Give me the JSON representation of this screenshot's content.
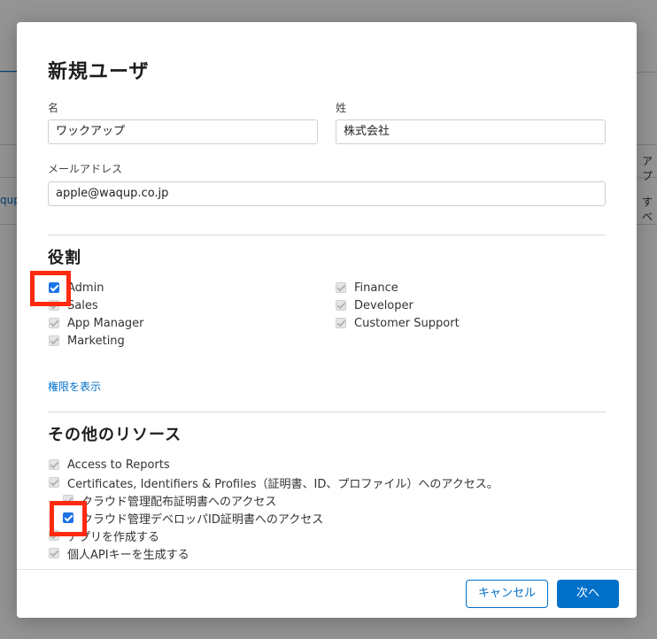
{
  "background": {
    "row1_link": "qup",
    "col_header": "アプ",
    "row1_cell": "すべ"
  },
  "modal": {
    "title": "新規ユーザ",
    "first_name": {
      "label": "名",
      "value": "ワックアップ"
    },
    "last_name": {
      "label": "姓",
      "value": "株式会社"
    },
    "email": {
      "label": "メールアドレス",
      "value": "apple@waqup.co.jp"
    },
    "roles": {
      "title": "役割",
      "left": [
        {
          "label": "Admin",
          "checked": true
        },
        {
          "label": "Sales",
          "checked": false
        },
        {
          "label": "App Manager",
          "checked": false
        },
        {
          "label": "Marketing",
          "checked": false
        }
      ],
      "right": [
        {
          "label": "Finance",
          "checked": false
        },
        {
          "label": "Developer",
          "checked": false
        },
        {
          "label": "Customer Support",
          "checked": false
        }
      ],
      "show_permissions_link": "権限を表示"
    },
    "other_resources": {
      "title": "その他のリソース",
      "items": [
        {
          "label": "Access to Reports",
          "checked": false
        },
        {
          "label": "Certificates, Identifiers & Profiles（証明書、ID、プロファイル）へのアクセス。",
          "checked": false
        },
        {
          "label": "クラウド管理配布証明書へのアクセス",
          "checked": false
        },
        {
          "label": "クラウド管理デベロッパID証明書へのアクセス",
          "checked": true
        },
        {
          "label": "アプリを作成する",
          "checked": false
        },
        {
          "label": "個人APIキーを生成する",
          "checked": false
        }
      ]
    },
    "footer": {
      "cancel_label": "キャンセル",
      "next_label": "次へ"
    }
  },
  "colors": {
    "accent": "#0070c9",
    "checkbox_checked": "#1a73e8",
    "highlight": "#ff2a10"
  }
}
